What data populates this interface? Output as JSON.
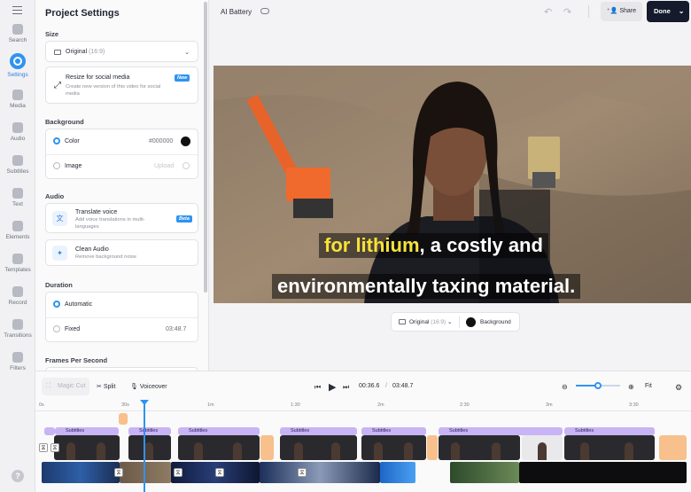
{
  "rail": {
    "items": [
      {
        "label": "Search",
        "icon": "search-icon"
      },
      {
        "label": "Settings",
        "icon": "settings-icon"
      },
      {
        "label": "Media",
        "icon": "media-icon"
      },
      {
        "label": "Audio",
        "icon": "audio-icon"
      },
      {
        "label": "Subtitles",
        "icon": "subtitles-icon"
      },
      {
        "label": "Text",
        "icon": "text-icon"
      },
      {
        "label": "Elements",
        "icon": "elements-icon"
      },
      {
        "label": "Templates",
        "icon": "templates-icon"
      },
      {
        "label": "Record",
        "icon": "record-icon"
      },
      {
        "label": "Transitions",
        "icon": "transitions-icon"
      },
      {
        "label": "Filters",
        "icon": "filters-icon"
      }
    ],
    "help": "?"
  },
  "panel": {
    "title": "Project Settings",
    "size": {
      "label": "Size",
      "dropdown_value": "Original",
      "dropdown_sub": "(16:9)",
      "resize_title": "Resize for social media",
      "resize_desc": "Create new version of this video for social media",
      "resize_badge": "New"
    },
    "background": {
      "label": "Background",
      "color_label": "Color",
      "color_value": "#000000",
      "image_label": "Image",
      "image_action": "Upload"
    },
    "audio": {
      "label": "Audio",
      "translate_title": "Translate voice",
      "translate_desc": "Add voice translations in multi-languages",
      "translate_badge": "Beta",
      "clean_title": "Clean Audio",
      "clean_desc": "Remove background noise"
    },
    "duration": {
      "label": "Duration",
      "automatic": "Automatic",
      "fixed": "Fixed",
      "fixed_value": "03:48.7"
    },
    "fps_label": "Frames Per Second"
  },
  "topbar": {
    "project_name": "AI Battery",
    "share": "Share",
    "done": "Done"
  },
  "video": {
    "caption_line1_highlight": "for lithium",
    "caption_line1_rest": ", a costly and",
    "caption_line2": "environmentally taxing material."
  },
  "ratio_chip": {
    "value": "Original",
    "sub": "(16:9)",
    "background": "Background"
  },
  "timeline": {
    "magic_cut": "Magic Cut",
    "split": "Split",
    "voiceover": "Voiceover",
    "current_time": "00:36.6",
    "separator": "/",
    "total_time": "03:48.7",
    "fit": "Fit",
    "zoom_level": 0.5,
    "ticks": [
      "0s",
      "30s",
      "1m",
      "1:30",
      "2m",
      "2:30",
      "3m",
      "3:30"
    ],
    "subtitle_label": "Subtitles"
  }
}
